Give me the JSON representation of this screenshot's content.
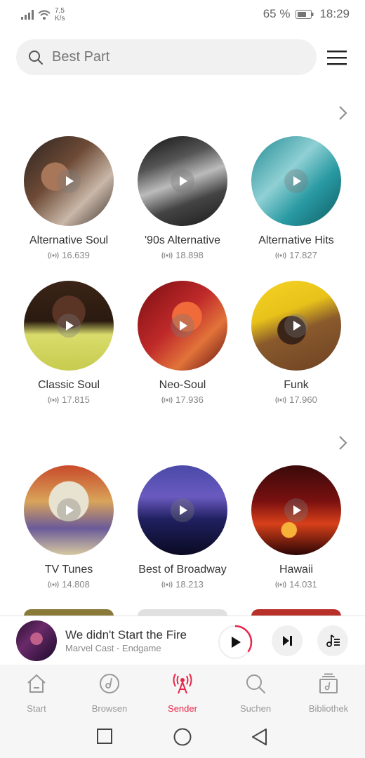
{
  "status": {
    "speed_value": "7,5",
    "speed_unit": "K/s",
    "battery": "65 %",
    "time": "18:29"
  },
  "search": {
    "placeholder": "Best Part"
  },
  "sections": [
    {
      "stations": [
        {
          "name": "Alternative Soul",
          "count": "16.639"
        },
        {
          "name": "'90s Alternative",
          "count": "18.898"
        },
        {
          "name": "Alternative Hits",
          "count": "17.827"
        },
        {
          "name": "Classic Soul",
          "count": "17.815"
        },
        {
          "name": "Neo-Soul",
          "count": "17.936"
        },
        {
          "name": "Funk",
          "count": "17.960"
        }
      ]
    },
    {
      "stations": [
        {
          "name": "TV Tunes",
          "count": "14.808"
        },
        {
          "name": "Best of Broadway",
          "count": "18.213"
        },
        {
          "name": "Hawaii",
          "count": "14.031"
        }
      ]
    }
  ],
  "now_playing": {
    "title": "We didn't Start the Fire",
    "subtitle": "Marvel Cast - Endgame",
    "progress": 0.35
  },
  "nav": [
    {
      "label": "Start",
      "icon": "home-icon"
    },
    {
      "label": "Browsen",
      "icon": "browse-disc-icon"
    },
    {
      "label": "Sender",
      "icon": "radio-tower-icon",
      "active": true
    },
    {
      "label": "Suchen",
      "icon": "search-icon"
    },
    {
      "label": "Bibliothek",
      "icon": "library-icon"
    }
  ],
  "colors": {
    "accent": "#e8264a"
  }
}
